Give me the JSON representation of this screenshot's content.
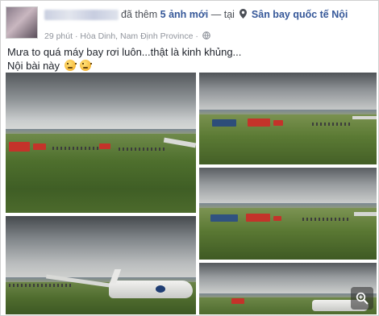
{
  "post": {
    "action_text": "đã thêm",
    "photo_count_text": "5 ảnh mới",
    "separator": "— tại",
    "location": "Sân bay quốc tế Nội",
    "time": "29 phút",
    "place": "Hòa Dinh, Nam Định Province",
    "dot": "·",
    "caption_line1": "Mưa to quá máy bay rơi luôn...thật là kinh khủng...",
    "caption_line2": "Nội bài này"
  },
  "icons": {
    "location": "map-pin-icon",
    "privacy": "globe-icon",
    "emoji": "confounded-face-emoji",
    "zoom": "magnifier-zoom-icon"
  },
  "colors": {
    "link": "#365899",
    "meta": "#90949c",
    "text": "#1d2129"
  }
}
